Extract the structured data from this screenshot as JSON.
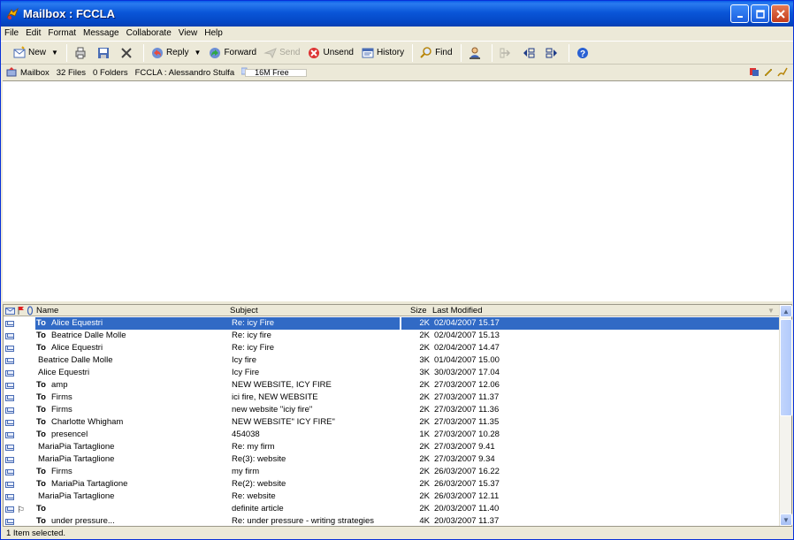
{
  "window": {
    "title": "Mailbox : FCCLA"
  },
  "menu": [
    "File",
    "Edit",
    "Format",
    "Message",
    "Collaborate",
    "View",
    "Help"
  ],
  "toolbar": {
    "new": "New",
    "reply": "Reply",
    "forward": "Forward",
    "send": "Send",
    "unsend": "Unsend",
    "history": "History",
    "find": "Find"
  },
  "info": {
    "mailbox": "Mailbox",
    "files": "32 Files",
    "folders": "0 Folders",
    "path": "FCCLA : Alessandro Stulfa",
    "free": "16M Free"
  },
  "list": {
    "columns": {
      "name": "Name",
      "subject": "Subject",
      "size": "Size",
      "modified": "Last Modified"
    },
    "rows": [
      {
        "to": "To",
        "name": "Alice Equestri",
        "subject": "Re: icy Fire",
        "size": "2K",
        "modified": "02/04/2007  15.17",
        "selected": true
      },
      {
        "to": "To",
        "name": "Beatrice Dalle Molle",
        "subject": "Re: icy fire",
        "size": "2K",
        "modified": "02/04/2007  15.13"
      },
      {
        "to": "To",
        "name": "Alice Equestri",
        "subject": "Re: icy Fire",
        "size": "2K",
        "modified": "02/04/2007  14.47"
      },
      {
        "to": "",
        "name": "Beatrice Dalle Molle",
        "subject": "Icy fire",
        "size": "3K",
        "modified": "01/04/2007  15.00"
      },
      {
        "to": "",
        "name": "Alice Equestri",
        "subject": "Icy Fire",
        "size": "3K",
        "modified": "30/03/2007  17.04"
      },
      {
        "to": "To",
        "name": "amp",
        "subject": "NEW WEBSITE, ICY FIRE",
        "size": "2K",
        "modified": "27/03/2007  12.06"
      },
      {
        "to": "To",
        "name": "Firms",
        "subject": "ici fire, NEW WEBSITE",
        "size": "2K",
        "modified": "27/03/2007  11.37"
      },
      {
        "to": "To",
        "name": "Firms",
        "subject": "new website \"iciy fire\"",
        "size": "2K",
        "modified": "27/03/2007  11.36"
      },
      {
        "to": "To",
        "name": "Charlotte Whigham",
        "subject": "NEW WEBSITE\" ICY FIRE\"",
        "size": "2K",
        "modified": "27/03/2007  11.35"
      },
      {
        "to": "To",
        "name": "presencel",
        "subject": "454038",
        "size": "1K",
        "modified": "27/03/2007  10.28"
      },
      {
        "to": "",
        "name": "MariaPia Tartaglione",
        "subject": "Re: my firm",
        "size": "2K",
        "modified": "27/03/2007  9.41"
      },
      {
        "to": "",
        "name": "MariaPia Tartaglione",
        "subject": "Re(3): website",
        "size": "2K",
        "modified": "27/03/2007  9.34"
      },
      {
        "to": "To",
        "name": "Firms",
        "subject": "my firm",
        "size": "2K",
        "modified": "26/03/2007  16.22"
      },
      {
        "to": "To",
        "name": "MariaPia Tartaglione",
        "subject": "Re(2): website",
        "size": "2K",
        "modified": "26/03/2007  15.37"
      },
      {
        "to": "",
        "name": "MariaPia Tartaglione",
        "subject": "Re: website",
        "size": "2K",
        "modified": "26/03/2007  12.11"
      },
      {
        "to": "To",
        "name": "",
        "subject": " definite article",
        "size": "2K",
        "modified": "20/03/2007  11.40",
        "flag": true
      },
      {
        "to": "To",
        "name": "under pressure...",
        "subject": "Re: under pressure - writing strategies",
        "size": "4K",
        "modified": "20/03/2007  11.37"
      }
    ]
  },
  "status": "1 Item selected."
}
